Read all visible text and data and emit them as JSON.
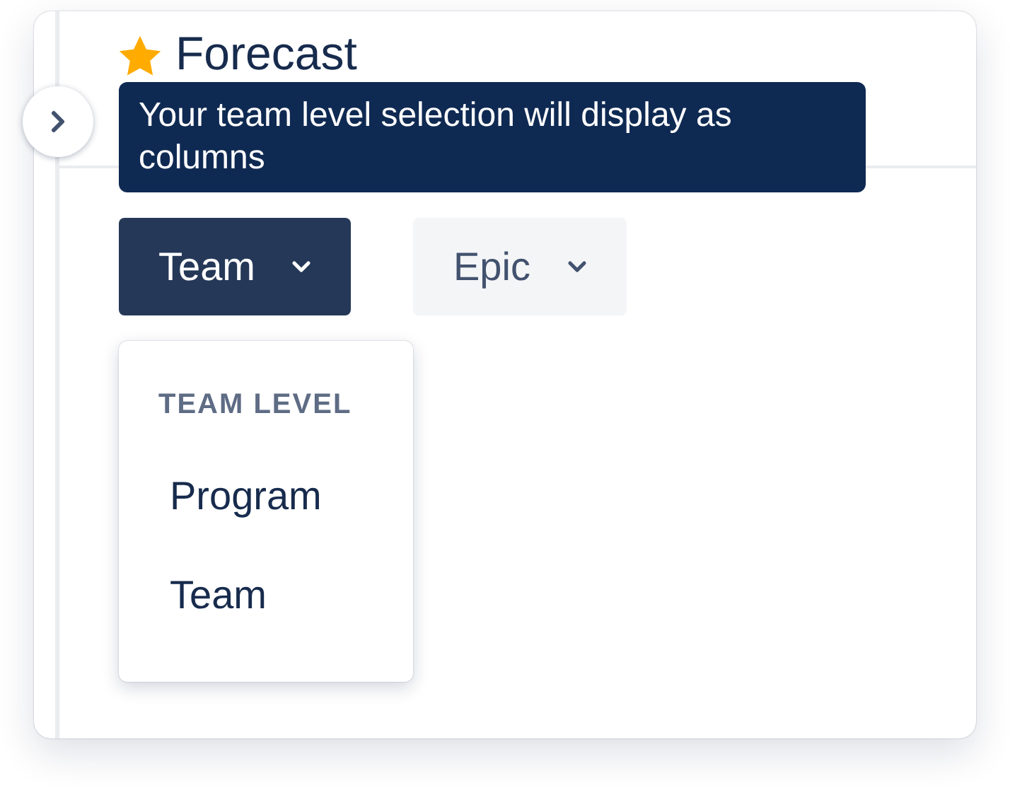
{
  "header": {
    "title": "Forecast",
    "starred": true
  },
  "tooltip": {
    "text": "Your team level selection will display as columns"
  },
  "buttons": [
    {
      "label": "Team",
      "selected": true,
      "expanded": true
    },
    {
      "label": "Epic",
      "selected": false,
      "expanded": false
    }
  ],
  "menu": {
    "heading": "TEAM LEVEL",
    "items": [
      {
        "label": "Program",
        "selected": false
      },
      {
        "label": "Team",
        "selected": false
      }
    ]
  }
}
